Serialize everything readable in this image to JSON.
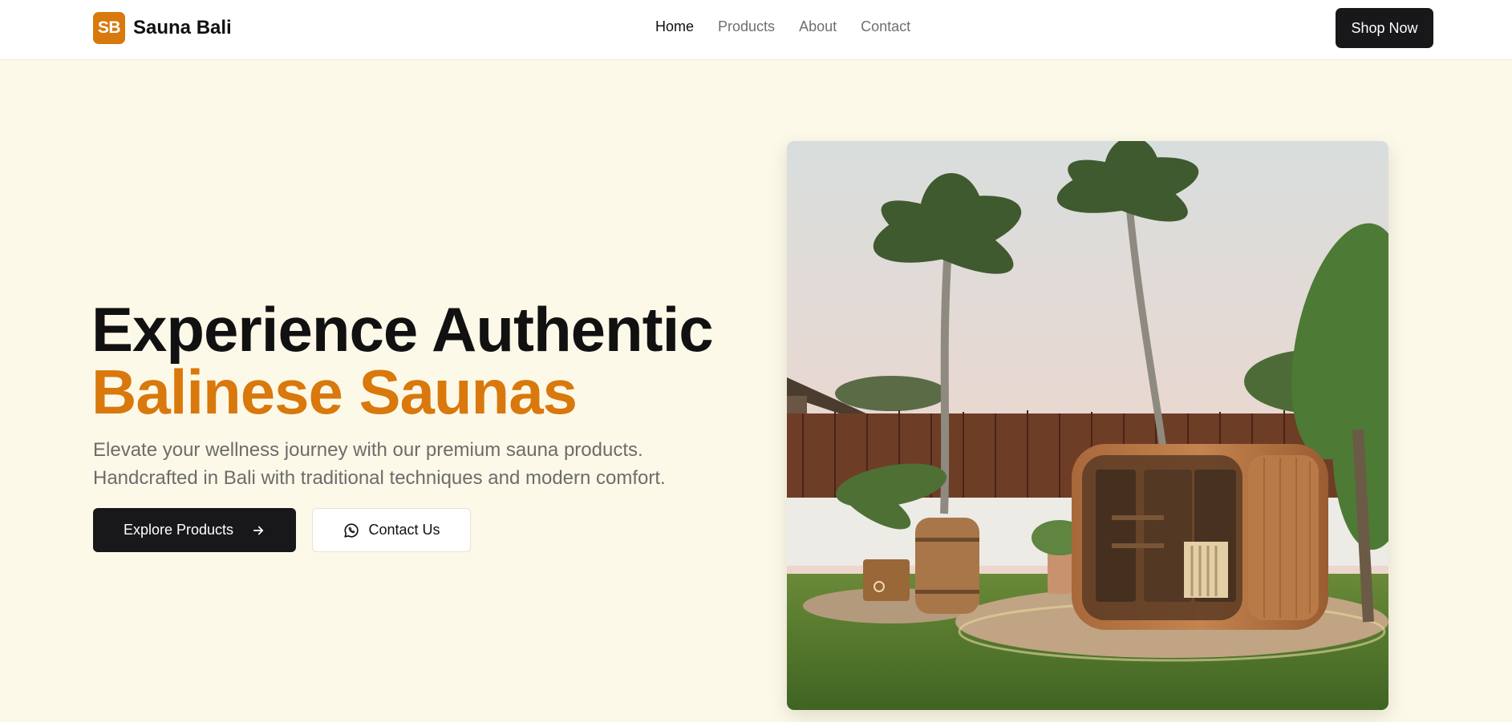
{
  "brand": {
    "badge": "SB",
    "name": "Sauna Bali",
    "accent": "#d9780c"
  },
  "nav": {
    "items": [
      "Home",
      "Products",
      "About",
      "Contact"
    ],
    "active": "Home"
  },
  "header": {
    "cta_label": "Shop Now"
  },
  "hero": {
    "headline_line1": "Experience Authentic",
    "headline_line2": "Balinese Saunas",
    "subtext_line1": "Elevate your wellness journey with our premium sauna products.",
    "subtext_line2": "Handcrafted in Bali with traditional techniques and modern comfort.",
    "primary_button": "Explore Products",
    "primary_icon": "arrow-right-icon",
    "secondary_button": "Contact Us",
    "secondary_icon": "whatsapp-icon"
  },
  "colors": {
    "background": "#fdf9e8",
    "dark_button": "#18181b"
  }
}
